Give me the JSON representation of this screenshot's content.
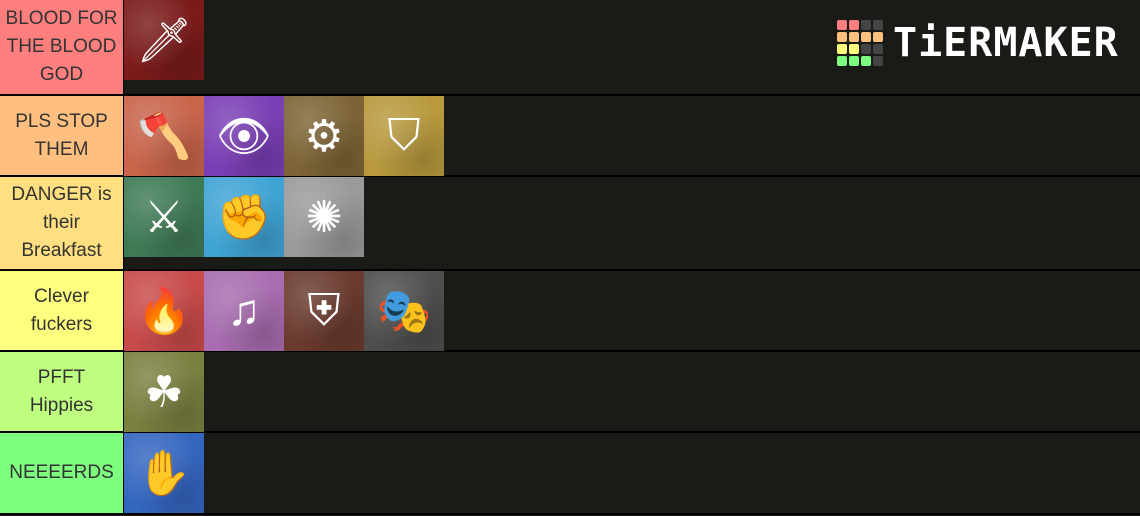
{
  "colors": {
    "background": "#1a1a17"
  },
  "logo": {
    "text": "TiERMAKER",
    "grid": [
      "#ff7f7f",
      "#ff7f7f",
      "#444",
      "#444",
      "#ffbf7f",
      "#ffbf7f",
      "#ffbf7f",
      "#ffbf7f",
      "#ffff7f",
      "#ffff7f",
      "#444",
      "#444",
      "#7fff7f",
      "#7fff7f",
      "#7fff7f",
      "#444"
    ]
  },
  "tiers": [
    {
      "label": "BLOOD FOR THE BLOOD GOD",
      "color": "#ff7f7f",
      "height": 95,
      "items": [
        {
          "icon": "blood-dagger-icon",
          "glyph": "🗡",
          "bg": "#7a1a1a"
        }
      ]
    },
    {
      "label": "PLS STOP THEM",
      "color": "#ffbf7f",
      "height": 80,
      "items": [
        {
          "icon": "battle-axe-icon",
          "glyph": "🪓",
          "bg": "#c8644a"
        },
        {
          "icon": "eye-icon",
          "glyph": "👁",
          "bg": "#7a3fb5"
        },
        {
          "icon": "gear-icon",
          "glyph": "⚙",
          "bg": "#7d6436"
        },
        {
          "icon": "winged-helm-icon",
          "glyph": "⛉",
          "bg": "#b8993d"
        }
      ]
    },
    {
      "label": "DANGER is their Breakfast",
      "color": "#ffdf7f",
      "height": 93,
      "items": [
        {
          "icon": "crossed-blades-paw-icon",
          "glyph": "⚔",
          "bg": "#3f7a55"
        },
        {
          "icon": "fist-icon",
          "glyph": "✊",
          "bg": "#3fa4d4"
        },
        {
          "icon": "mace-icon",
          "glyph": "✺",
          "bg": "#9a9a9a"
        }
      ]
    },
    {
      "label": "Clever fuckers",
      "color": "#ffff7f",
      "height": 80,
      "items": [
        {
          "icon": "flame-drop-icon",
          "glyph": "🔥",
          "bg": "#c84a4a"
        },
        {
          "icon": "lute-icon",
          "glyph": "♫",
          "bg": "#a86cb0"
        },
        {
          "icon": "shield-axe-sword-icon",
          "glyph": "⛨",
          "bg": "#6a3a2e"
        },
        {
          "icon": "mask-dagger-icon",
          "glyph": "🎭",
          "bg": "#4e4e4c"
        }
      ]
    },
    {
      "label": "PFFT Hippies",
      "color": "#bfff7f",
      "height": 80,
      "items": [
        {
          "icon": "sickle-leaves-icon",
          "glyph": "☘",
          "bg": "#7a8040"
        }
      ]
    },
    {
      "label": "NEEEERDS",
      "color": "#7fff7f",
      "height": 81,
      "items": [
        {
          "icon": "magic-hand-icon",
          "glyph": "✋",
          "bg": "#3466c0"
        }
      ]
    }
  ]
}
